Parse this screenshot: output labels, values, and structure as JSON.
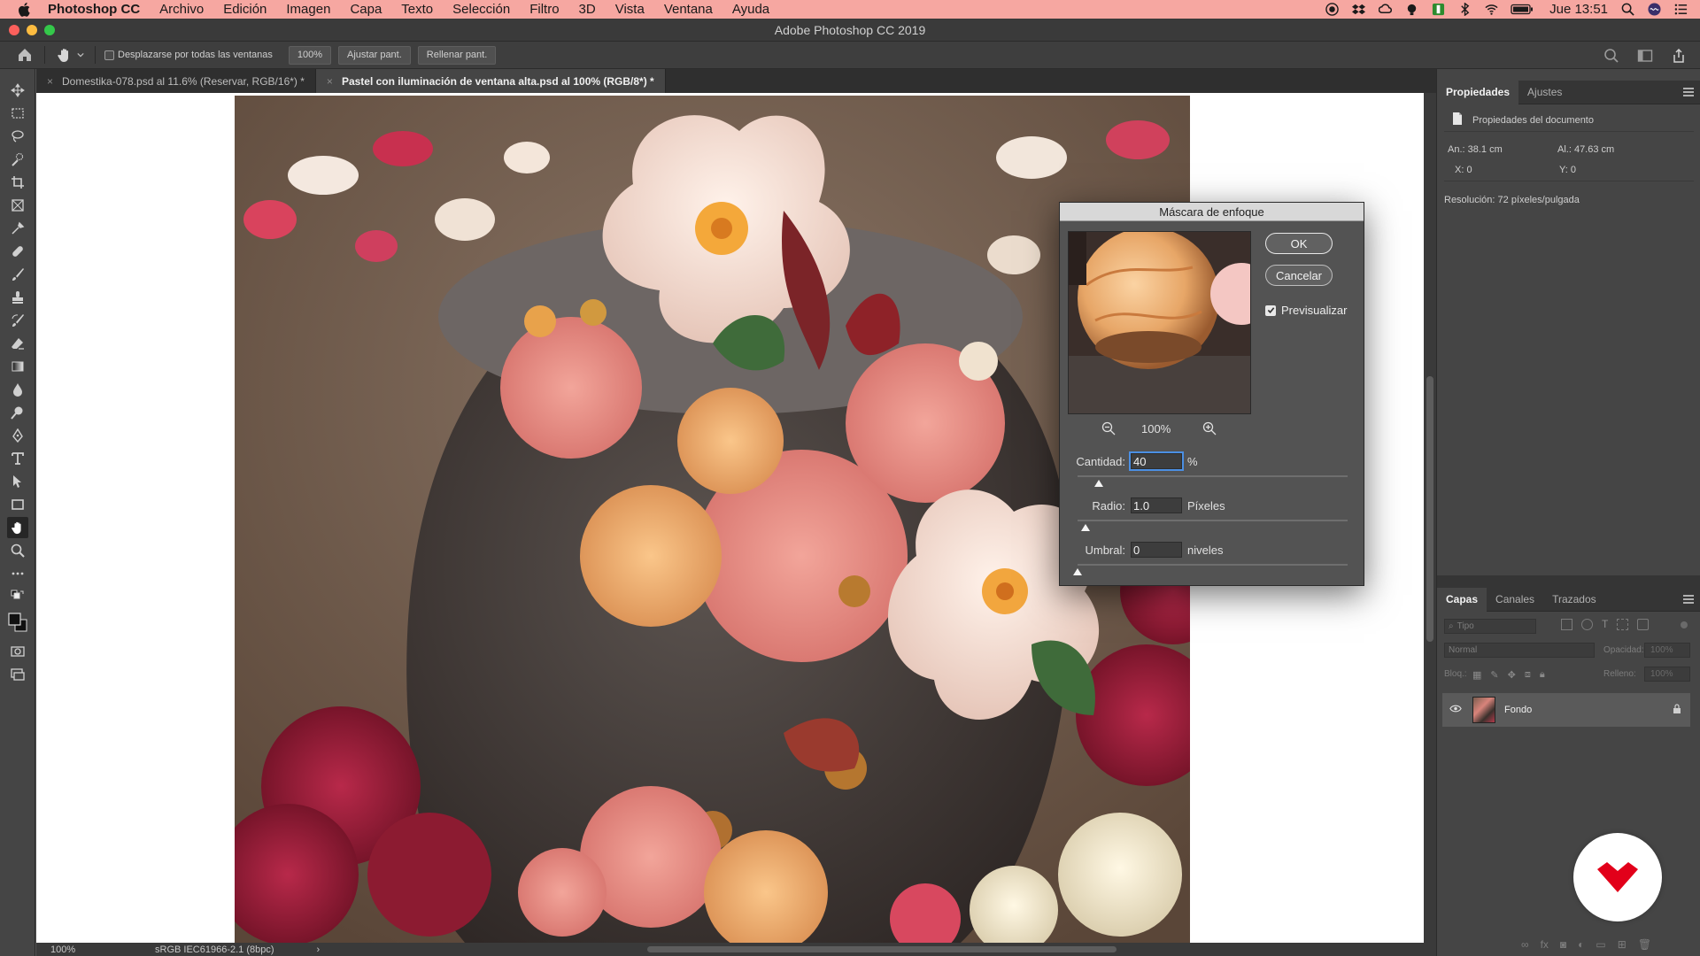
{
  "menubar": {
    "app_name": "Photoshop CC",
    "items": [
      "Archivo",
      "Edición",
      "Imagen",
      "Capa",
      "Texto",
      "Selección",
      "Filtro",
      "3D",
      "Vista",
      "Ventana",
      "Ayuda"
    ],
    "clock": "Jue 13:51"
  },
  "window": {
    "title": "Adobe Photoshop CC 2019"
  },
  "options": {
    "scroll_all_label": "Desplazarse por todas las ventanas",
    "zoom_label": "100%",
    "fit_label": "Ajustar pant.",
    "fill_label": "Rellenar pant."
  },
  "tabs": [
    {
      "label": "Domestika-078.psd al 11.6% (Reservar, RGB/16*) *"
    },
    {
      "label": "Pastel con iluminación de ventana alta.psd al 100% (RGB/8*) *"
    }
  ],
  "status": {
    "zoom": "100%",
    "profile": "sRGB IEC61966-2.1 (8bpc)",
    "arrow": "›"
  },
  "properties": {
    "tabs": [
      "Propiedades",
      "Ajustes"
    ],
    "section": "Propiedades del documento",
    "width": "An.: 38.1 cm",
    "height": "Al.: 47.63 cm",
    "x": "X: 0",
    "y": "Y: 0",
    "resolution": "Resolución: 72 píxeles/pulgada"
  },
  "layers": {
    "tabs": [
      "Capas",
      "Canales",
      "Trazados"
    ],
    "filter_placeholder": "Tipo",
    "blend_mode": "Normal",
    "opacity_label": "Opacidad:",
    "opacity_value": "100%",
    "lock_label": "Bloq.:",
    "fill_label": "Relleno:",
    "fill_value": "100%",
    "items": [
      {
        "name": "Fondo"
      }
    ]
  },
  "dialog": {
    "title": "Máscara de enfoque",
    "ok": "OK",
    "cancel": "Cancelar",
    "preview_label": "Previsualizar",
    "preview_checked": true,
    "zoom": "100%",
    "amount_label": "Cantidad:",
    "amount_value": "40",
    "amount_unit": "%",
    "amount_fraction": 0.08,
    "radius_label": "Radio:",
    "radius_value": "1.0",
    "radius_unit": "Píxeles",
    "radius_fraction": 0.03,
    "threshold_label": "Umbral:",
    "threshold_value": "0",
    "threshold_unit": "niveles",
    "threshold_fraction": 0.0
  },
  "colors": {
    "menubar_bg": "#f6a7a1",
    "accent_focus": "#4b8fe3",
    "brand_red": "#e2001a"
  }
}
